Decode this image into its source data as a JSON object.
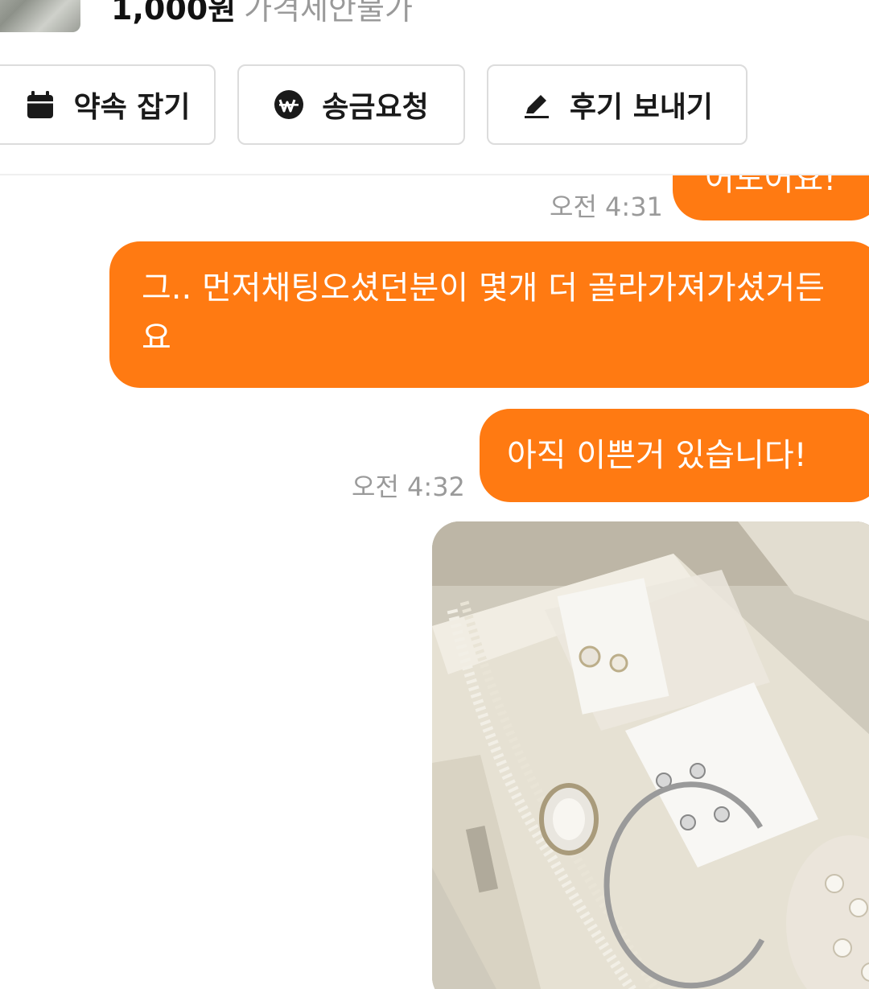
{
  "product": {
    "price": "1,000원",
    "negotiation": "가격제안불가"
  },
  "actions": {
    "promise_label": "약속 잡기",
    "remit_label": "송금요청",
    "review_label": "후기 보내기"
  },
  "messages": [
    {
      "text": "어도어요!",
      "time": "오전 4:31",
      "sender": "me"
    },
    {
      "text": "그.. 먼저채팅오셨던분이 몇개 더 골라가져가셨거든요",
      "sender": "me"
    },
    {
      "text": "아직 이쁜거 있습니다!",
      "time": "오전 4:32",
      "sender": "me"
    }
  ],
  "colors": {
    "bubble": "#ff7a12",
    "time_text": "#9a9a9a",
    "button_border": "#dcdcdc"
  },
  "icons": [
    "calendar-icon",
    "won-icon",
    "pencil-icon"
  ]
}
